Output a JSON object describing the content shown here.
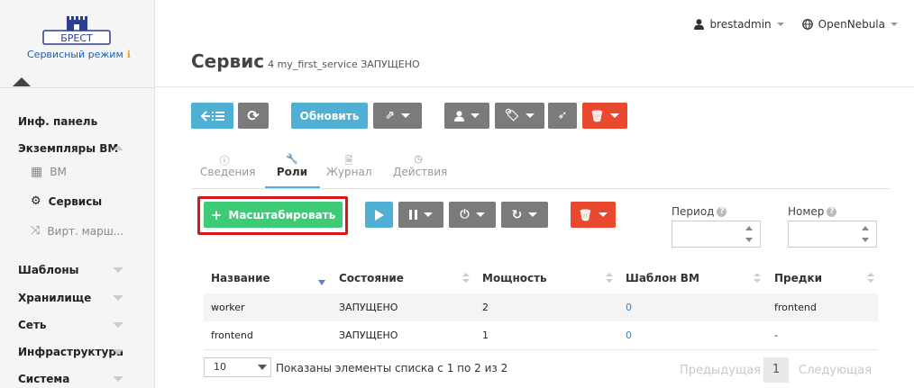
{
  "brand": {
    "logo_text": "БРЕСТ",
    "mode_label": "Сервисный режим"
  },
  "sidebar": {
    "items": [
      {
        "label": "Инф. панель"
      },
      {
        "label": "Экземпляры ВМ"
      },
      {
        "label": "Шаблоны"
      },
      {
        "label": "Хранилище"
      },
      {
        "label": "Сеть"
      },
      {
        "label": "Инфраструктура"
      },
      {
        "label": "Система"
      }
    ],
    "subitems": [
      {
        "label": "ВМ",
        "icon": "grid-icon"
      },
      {
        "label": "Сервисы",
        "icon": "services-icon"
      },
      {
        "label": "Вирт. марш...",
        "icon": "router-icon"
      }
    ]
  },
  "topbar": {
    "user": "brestadmin",
    "zone": "OpenNebula"
  },
  "page": {
    "title": "Сервис",
    "subtitle": "4 my_first_service ЗАПУЩЕНО"
  },
  "toolbar": {
    "refresh_label": "Обновить"
  },
  "tabs": [
    {
      "label": "Сведения",
      "icon": "info-icon"
    },
    {
      "label": "Роли",
      "icon": "wrench-icon"
    },
    {
      "label": "Журнал",
      "icon": "file-icon"
    },
    {
      "label": "Действия",
      "icon": "clock-icon"
    }
  ],
  "roles": {
    "scale_label": "Масштабировать",
    "period_label": "Период",
    "number_label": "Номер",
    "columns": [
      "Название",
      "Состояние",
      "Мощность",
      "Шаблон ВМ",
      "Предки"
    ],
    "rows": [
      [
        "worker",
        "ЗАПУЩЕНО",
        "2",
        "0",
        "frontend"
      ],
      [
        "frontend",
        "ЗАПУЩЕНО",
        "1",
        "0",
        "-"
      ]
    ]
  },
  "pagination": {
    "page_size": "10",
    "info": "Показаны элементы списка с 1 по 2 из 2",
    "prev": "Предыдущая",
    "current": "1",
    "next": "Следующая"
  },
  "colors": {
    "teal": "#4fb0d4",
    "grey": "#7b7b7b",
    "red": "#e8492f",
    "green": "#3ecb76",
    "highlight": "#d9161b"
  }
}
